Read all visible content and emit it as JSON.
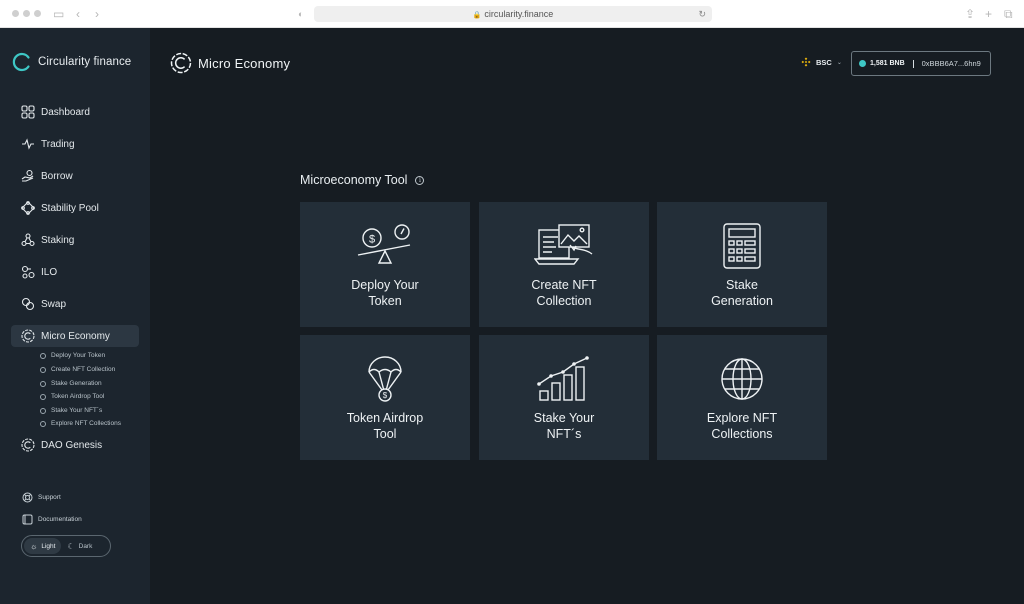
{
  "browser": {
    "url": "circularity.finance"
  },
  "sidebar": {
    "brand": "Circularity finance",
    "items": [
      {
        "label": "Dashboard",
        "icon": "grid-icon"
      },
      {
        "label": "Trading",
        "icon": "pulse-icon"
      },
      {
        "label": "Borrow",
        "icon": "hand-coin-icon"
      },
      {
        "label": "Stability Pool",
        "icon": "nodes-icon"
      },
      {
        "label": "Staking",
        "icon": "molecule-icon"
      },
      {
        "label": "ILO",
        "icon": "coins-icon"
      },
      {
        "label": "Swap",
        "icon": "swap-icon"
      },
      {
        "label": "Micro Economy",
        "icon": "circularity-icon"
      },
      {
        "label": "DAO Genesis",
        "icon": "circularity-icon"
      }
    ],
    "sub_items": [
      "Deploy Your Token",
      "Create NFT Collection",
      "Stake Generation",
      "Token Airdrop Tool",
      "Stake Your NFT´s",
      "Explore NFT Collections"
    ],
    "footer": {
      "support": "Support",
      "documentation": "Documentation",
      "theme_light": "Light",
      "theme_dark": "Dark"
    }
  },
  "header": {
    "title": "Micro Economy",
    "network": "BSC",
    "balance": "1,581 BNB",
    "address": "0xBBB6A7...6hn9"
  },
  "tool": {
    "title": "Microeconomy Tool",
    "cards": [
      {
        "label": "Deploy Your\nToken",
        "icon": "seesaw-coins-icon"
      },
      {
        "label": "Create NFT\nCollection",
        "icon": "laptop-image-icon"
      },
      {
        "label": "Stake\nGeneration",
        "icon": "calculator-icon"
      },
      {
        "label": "Token Airdrop\nTool",
        "icon": "parachute-coin-icon"
      },
      {
        "label": "Stake Your\nNFT´s",
        "icon": "growth-chart-icon"
      },
      {
        "label": "Explore NFT\nCollections",
        "icon": "globe-icon"
      }
    ]
  },
  "colors": {
    "background": "#161c22",
    "sidebar": "#1c252e",
    "card": "#232e38",
    "accent": "#3ec7c5",
    "bsc": "#f0b90b"
  }
}
